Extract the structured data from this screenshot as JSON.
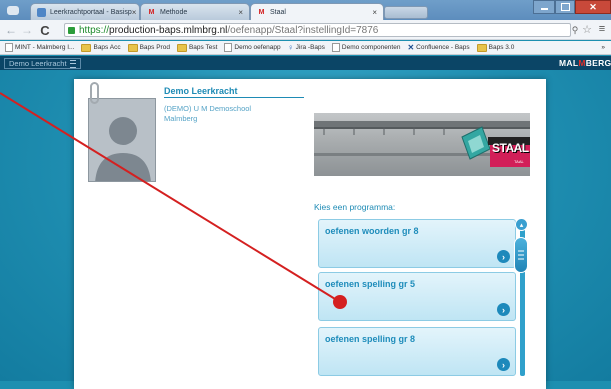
{
  "browser": {
    "tabs": [
      {
        "label": "Leerkrachtportaal - Basisp",
        "icon": "page-icon"
      },
      {
        "label": "Methode",
        "icon": "malmberg-m-icon"
      },
      {
        "label": "Staal",
        "icon": "malmberg-m-icon"
      }
    ],
    "tab_close": "×",
    "url": {
      "scheme": "https://",
      "host": "production-baps.mlmbrg.nl",
      "path": "/oefenapp/Staal?instellingId=7876"
    },
    "bookmarks": [
      {
        "label": "MINT - Malmberg I...",
        "icon": "page-icon"
      },
      {
        "label": "Baps Acc",
        "icon": "folder-icon"
      },
      {
        "label": "Baps Prod",
        "icon": "folder-icon"
      },
      {
        "label": "Baps Test",
        "icon": "folder-icon"
      },
      {
        "label": "Demo oefenapp",
        "icon": "page-icon"
      },
      {
        "label": "Jira -Baps",
        "icon": "jira-icon"
      },
      {
        "label": "Demo componenten",
        "icon": "page-icon"
      },
      {
        "label": "Confluence - Baps",
        "icon": "confluence-icon"
      },
      {
        "label": "Baps 3.0",
        "icon": "folder-icon"
      }
    ],
    "bookmarks_overflow": "»"
  },
  "app": {
    "user_button": "Demo Leerkracht",
    "logo_left": "MAL",
    "logo_mid": "M",
    "logo_right": "BERG"
  },
  "profile": {
    "name": "Demo Leerkracht",
    "school_line1": "(DEMO) U M Demoschool",
    "school_line2": "Malmberg"
  },
  "banner": {
    "title": "STAAL",
    "subtitle": "TAAL"
  },
  "programs": {
    "heading": "Kies een programma:",
    "items": [
      {
        "label": "oefenen woorden gr 8"
      },
      {
        "label": "oefenen spelling gr 5"
      },
      {
        "label": "oefenen spelling gr 8"
      }
    ]
  },
  "colors": {
    "accent": "#1e8bb5",
    "header": "#0b4566",
    "pointer": "#d42020"
  }
}
